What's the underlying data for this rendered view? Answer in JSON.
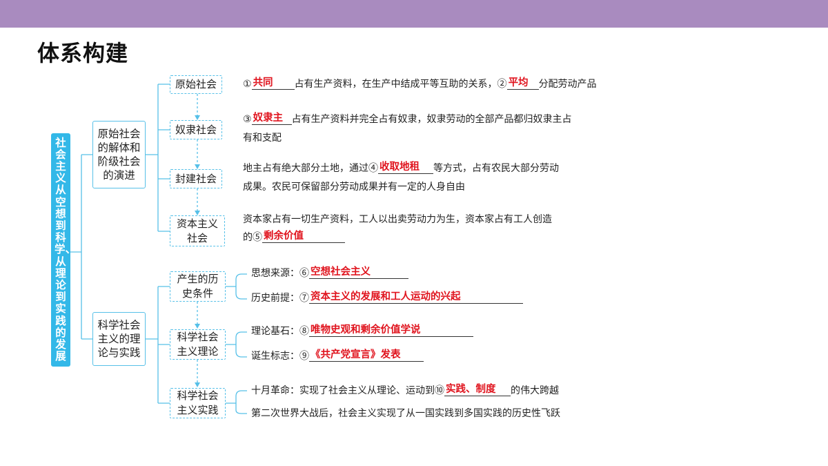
{
  "title": "体系构建",
  "root": "社会主义从空想到科学、从理论到实践的发展",
  "branch1": {
    "label": "原始社会的解体和阶级社会的演进",
    "nodes": [
      {
        "label": "原始社会",
        "pre1": "①",
        "ans1": "共同",
        "mid": "占有生产资料，在生产中结成平等互助的关系，②",
        "ans2": "平均",
        "post": "分配劳动产品"
      },
      {
        "label": "奴隶社会",
        "pre": "③",
        "ans": "奴隶主",
        "post": "占有生产资料并完全占有奴隶，奴隶劳动的全部产品都归奴隶主占",
        "line2": "有和支配"
      },
      {
        "label": "封建社会",
        "pre": "地主占有绝大部分土地，通过④",
        "ans": "收取地租",
        "post": "等方式，占有农民大部分劳动",
        "line2": "成果。农民可保留部分劳动成果并有一定的人身自由"
      },
      {
        "label": "资本主义社会",
        "line1": "资本家占有一切生产资料，工人以出卖劳动力为生，资本家占有工人创造",
        "pre": "的⑤",
        "ans": "剩余价值"
      }
    ]
  },
  "branch2": {
    "label": "科学社会主义的理论与实践",
    "nodes": [
      {
        "label": "产生的历史条件",
        "items": [
          {
            "pre": "思想来源：⑥",
            "ans": "空想社会主义"
          },
          {
            "pre": "历史前提：⑦",
            "ans": "资本主义的发展和工人运动的兴起"
          }
        ]
      },
      {
        "label": "科学社会主义理论",
        "items": [
          {
            "pre": "理论基石：⑧",
            "ans": "唯物史观和剩余价值学说"
          },
          {
            "pre": "诞生标志：⑨",
            "ans": "《共产党宣言》发表"
          }
        ]
      },
      {
        "label": "科学社会主义实践",
        "items": [
          {
            "pre": "十月革命：实现了社会主义从理论、运动到⑩",
            "ans": "实践、制度",
            "post": "的伟大跨越"
          },
          {
            "text": "第二次世界大战后，社会主义实现了从一国实践到多国实践的历史性飞跃"
          }
        ]
      }
    ]
  }
}
